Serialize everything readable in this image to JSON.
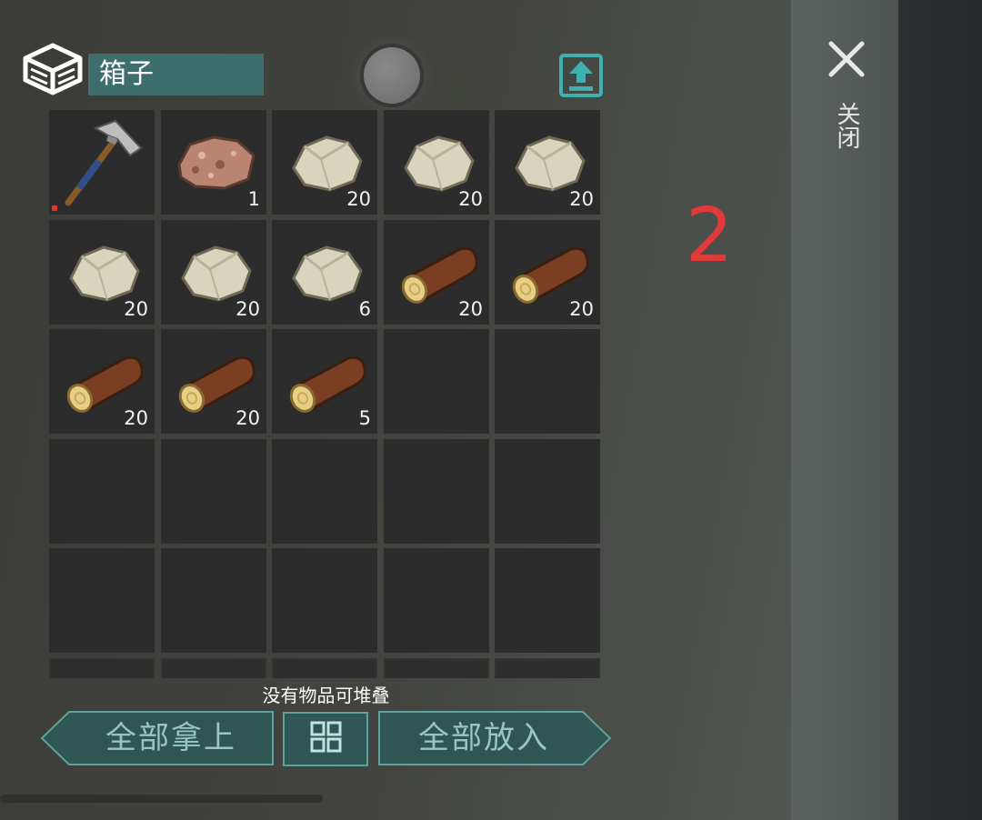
{
  "container": {
    "title": "箱子"
  },
  "slots": [
    {
      "item": "pickaxe-icon",
      "count": ""
    },
    {
      "item": "copper-ore-icon",
      "count": "1"
    },
    {
      "item": "stone-icon",
      "count": "20"
    },
    {
      "item": "stone-icon",
      "count": "20"
    },
    {
      "item": "stone-icon",
      "count": "20"
    },
    {
      "item": "stone-icon",
      "count": "20"
    },
    {
      "item": "stone-icon",
      "count": "20"
    },
    {
      "item": "stone-icon",
      "count": "6"
    },
    {
      "item": "log-icon",
      "count": "20"
    },
    {
      "item": "log-icon",
      "count": "20"
    },
    {
      "item": "log-icon",
      "count": "20"
    },
    {
      "item": "log-icon",
      "count": "20"
    },
    {
      "item": "log-icon",
      "count": "5"
    }
  ],
  "status": {
    "stack_message": "没有物品可堆叠"
  },
  "buttons": {
    "take_all": "全部拿上",
    "put_all": "全部放入"
  },
  "close": {
    "label": "关闭"
  },
  "annotation": {
    "number": "2"
  },
  "colors": {
    "accent": "#3e6e6b",
    "button_text": "#97c7c2",
    "annotation": "#e13a3a"
  }
}
